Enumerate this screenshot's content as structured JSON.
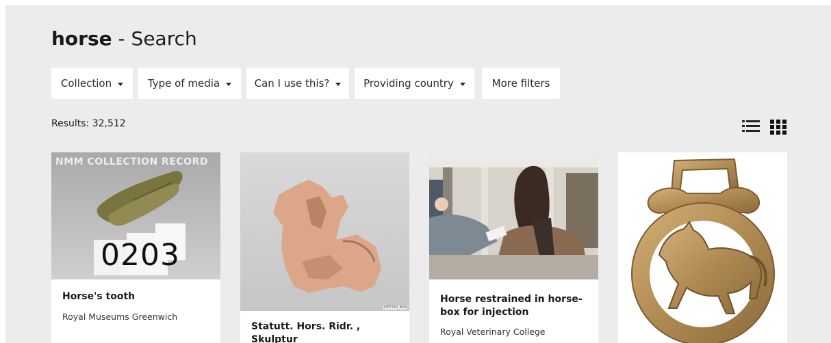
{
  "search": {
    "query": "horse",
    "title_suffix": " - Search"
  },
  "filters": [
    {
      "label": "Collection",
      "has_dropdown": true
    },
    {
      "label": "Type of media",
      "has_dropdown": true
    },
    {
      "label": "Can I use this?",
      "has_dropdown": true
    },
    {
      "label": "Providing country",
      "has_dropdown": true
    },
    {
      "label": "More filters",
      "has_dropdown": false
    }
  ],
  "results": {
    "count_label": "Results: 32,512"
  },
  "view_toggle": {
    "icons": [
      "list-view-icon",
      "grid-view-icon"
    ],
    "active": "grid"
  },
  "cards": [
    {
      "title": "Horse's tooth",
      "source": "Royal Museums Greenwich",
      "image_overlay": "NMM COLLECTION RECORD",
      "image_label": "0203"
    },
    {
      "title": "Statutt. Hors. Ridr. , Skulptur",
      "source": "",
      "image_caption": "I207316_Bild"
    },
    {
      "title": "Horse restrained in horse-box for injection",
      "source": "Royal Veterinary College"
    },
    {
      "title": "",
      "source": ""
    }
  ],
  "colors": {
    "page_background": "#ececec",
    "card_background": "#ffffff",
    "text": "#1a1a1a"
  }
}
